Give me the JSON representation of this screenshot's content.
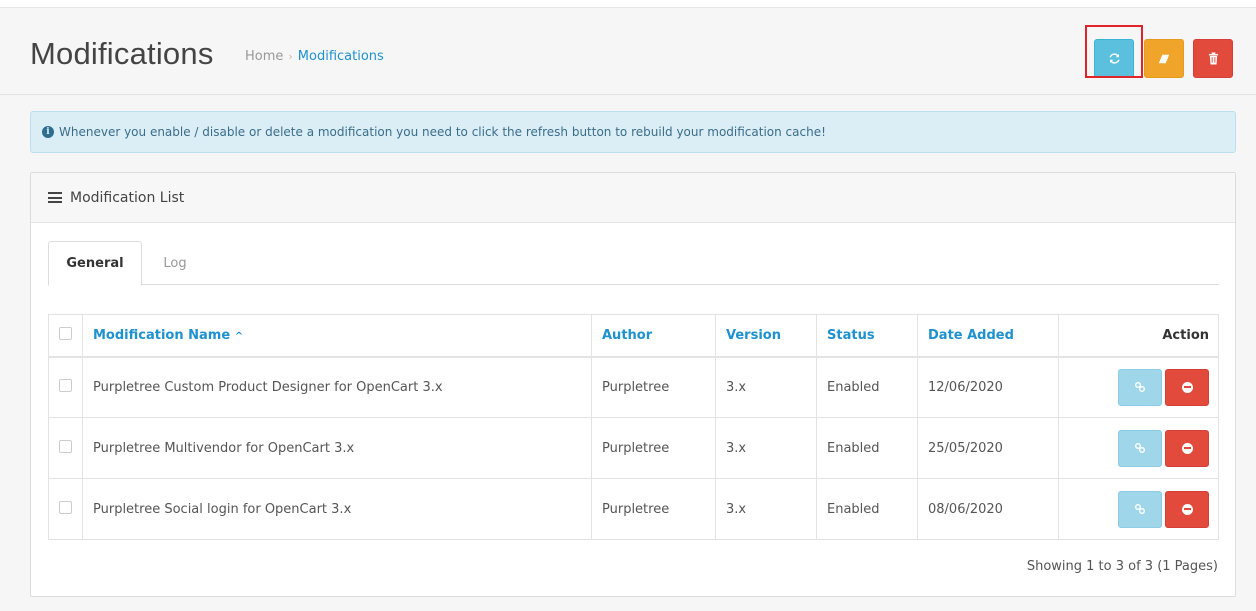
{
  "header": {
    "title": "Modifications",
    "breadcrumb": [
      {
        "label": "Home"
      },
      {
        "label": "Modifications"
      }
    ],
    "buttons": {
      "refresh_icon": "refresh-icon",
      "clear_icon": "eraser-icon",
      "delete_icon": "trash-icon"
    }
  },
  "alert": {
    "icon": "info-circle-icon",
    "text": "Whenever you enable / disable or delete a modification you need to click the refresh button to rebuild your modification cache!"
  },
  "panel": {
    "title": "Modification List",
    "icon": "list-icon"
  },
  "tabs": [
    {
      "label": "General",
      "active": true
    },
    {
      "label": "Log",
      "active": false
    }
  ],
  "table": {
    "headers": {
      "name": "Modification Name",
      "sort_indicator": "^",
      "author": "Author",
      "version": "Version",
      "status": "Status",
      "date_added": "Date Added",
      "action": "Action"
    },
    "rows": [
      {
        "name": "Purpletree Custom Product Designer for OpenCart 3.x",
        "author": "Purpletree",
        "version": "3.x",
        "status": "Enabled",
        "date_added": "12/06/2020"
      },
      {
        "name": "Purpletree Multivendor for OpenCart 3.x",
        "author": "Purpletree",
        "version": "3.x",
        "status": "Enabled",
        "date_added": "25/05/2020"
      },
      {
        "name": "Purpletree Social login for OpenCart 3.x",
        "author": "Purpletree",
        "version": "3.x",
        "status": "Enabled",
        "date_added": "08/06/2020"
      }
    ]
  },
  "pagination": {
    "text": "Showing 1 to 3 of 3 (1 Pages)"
  },
  "colors": {
    "primary_link": "#1e91cf",
    "info_button": "#5bc0de",
    "warning_button": "#f0a429",
    "danger_button": "#e24a3b",
    "highlight_box": "#e0242a"
  }
}
